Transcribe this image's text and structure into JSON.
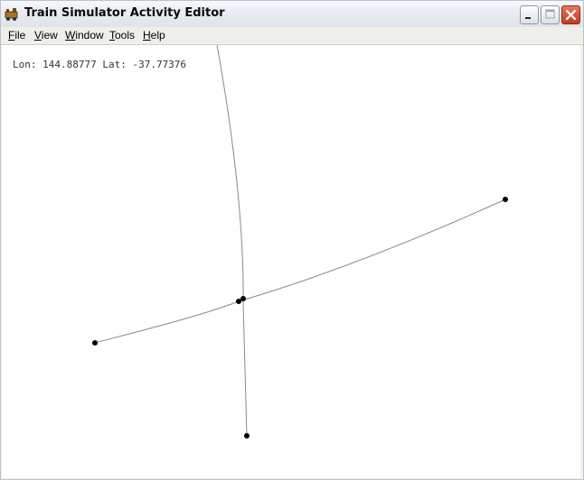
{
  "window": {
    "title": "Train Simulator Activity Editor"
  },
  "menubar": {
    "items": [
      {
        "mnemonic": "F",
        "rest": "ile"
      },
      {
        "mnemonic": "V",
        "rest": "iew"
      },
      {
        "mnemonic": "W",
        "rest": "indow"
      },
      {
        "mnemonic": "T",
        "rest": "ools"
      },
      {
        "mnemonic": "H",
        "rest": "elp"
      }
    ]
  },
  "canvas": {
    "coordinates": "Lon: 144.88777 Lat: -37.77376",
    "colors": {
      "background": "#ffffff",
      "track": "#8a8a8a",
      "node": "#000000"
    }
  }
}
